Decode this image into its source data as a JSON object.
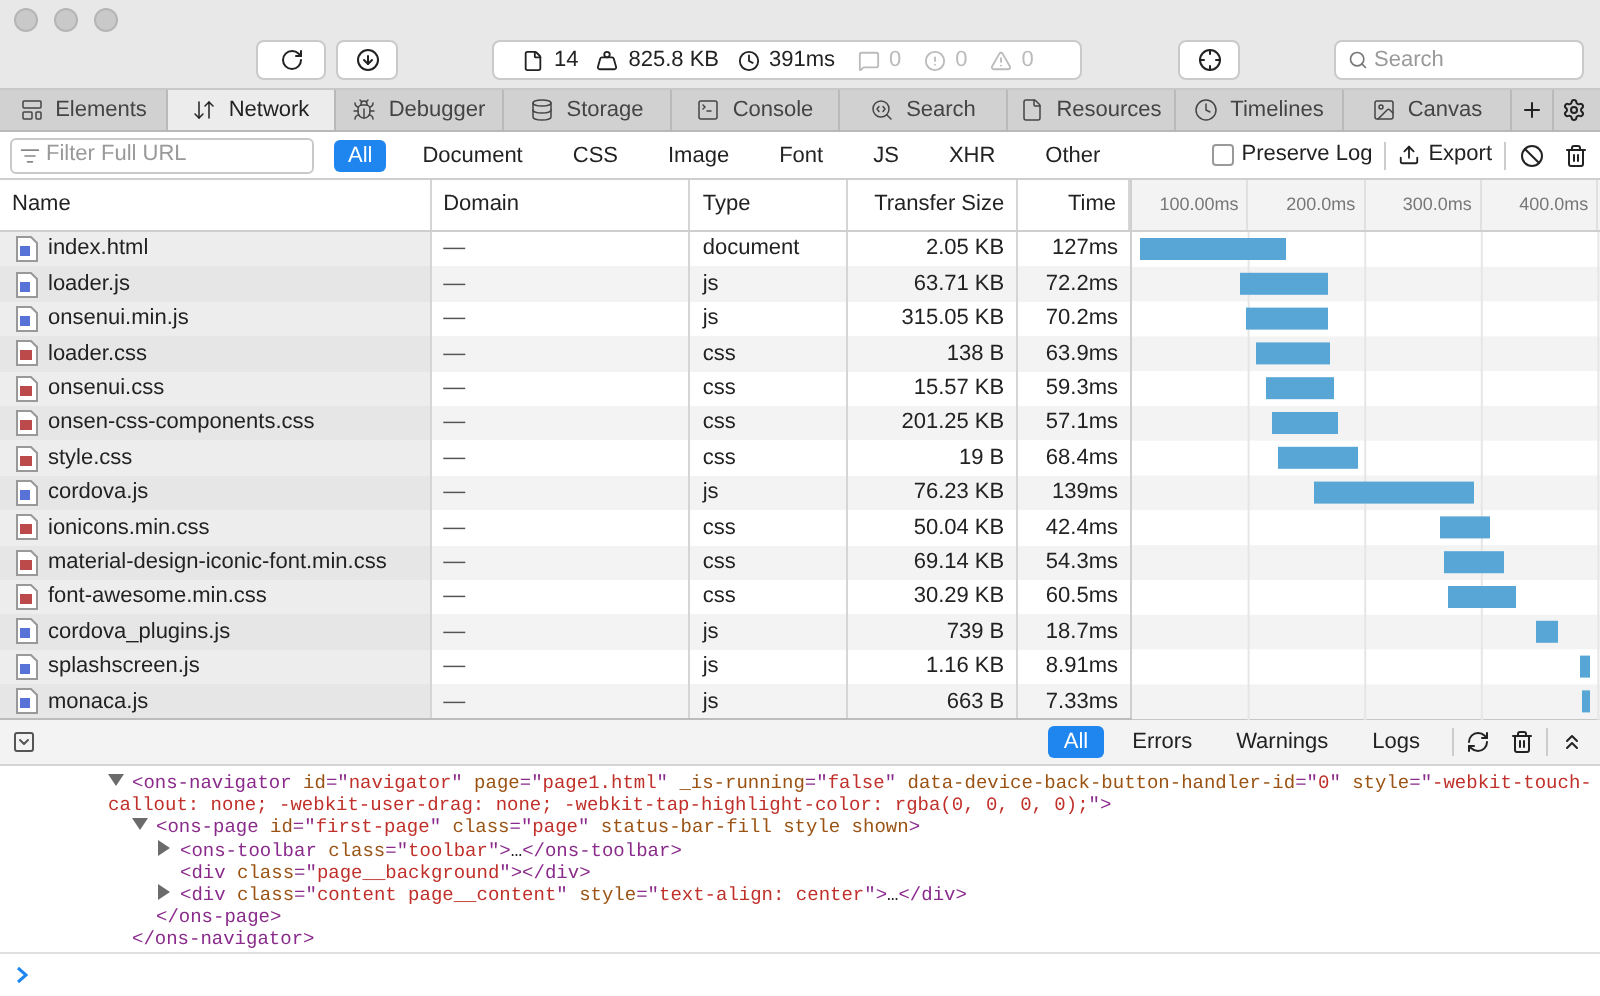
{
  "toolbar": {
    "resource_count": "14",
    "size": "825.8 KB",
    "time": "391ms",
    "messages": "0",
    "errors": "0",
    "warnings": "0",
    "search": {
      "placeholder": "Search"
    }
  },
  "tabs": [
    {
      "label": "Elements",
      "kind": "elements",
      "selected": false
    },
    {
      "label": "Network",
      "kind": "network",
      "selected": true
    },
    {
      "label": "Debugger",
      "kind": "debugger",
      "selected": false
    },
    {
      "label": "Storage",
      "kind": "storage",
      "selected": false
    },
    {
      "label": "Console",
      "kind": "console",
      "selected": false
    },
    {
      "label": "Search",
      "kind": "search",
      "selected": false
    },
    {
      "label": "Resources",
      "kind": "resources",
      "selected": false
    },
    {
      "label": "Timelines",
      "kind": "timelines",
      "selected": false
    },
    {
      "label": "Canvas",
      "kind": "canvas",
      "selected": false
    }
  ],
  "filter_bar": {
    "placeholder": "Filter Full URL",
    "filters": [
      {
        "label": "All",
        "selected": true
      },
      {
        "label": "Document",
        "selected": false
      },
      {
        "label": "CSS",
        "selected": false
      },
      {
        "label": "Image",
        "selected": false
      },
      {
        "label": "Font",
        "selected": false
      },
      {
        "label": "JS",
        "selected": false
      },
      {
        "label": "XHR",
        "selected": false
      },
      {
        "label": "Other",
        "selected": false
      }
    ],
    "preserve_log": {
      "label": "Preserve Log",
      "checked": false
    },
    "export": "Export"
  },
  "table": {
    "columns": [
      "Name",
      "Domain",
      "Type",
      "Transfer Size",
      "Time"
    ],
    "rows": [
      {
        "kind": "document",
        "name": "index.html",
        "domain": "—",
        "type": "document",
        "size": "2.05 KB",
        "time": "127ms"
      },
      {
        "kind": "script",
        "name": "loader.js",
        "domain": "—",
        "type": "js",
        "size": "63.71 KB",
        "time": "72.2ms"
      },
      {
        "kind": "script",
        "name": "onsenui.min.js",
        "domain": "—",
        "type": "js",
        "size": "315.05 KB",
        "time": "70.2ms"
      },
      {
        "kind": "stylesheet",
        "name": "loader.css",
        "domain": "—",
        "type": "css",
        "size": "138 B",
        "time": "63.9ms"
      },
      {
        "kind": "stylesheet",
        "name": "onsenui.css",
        "domain": "—",
        "type": "css",
        "size": "15.57 KB",
        "time": "59.3ms"
      },
      {
        "kind": "stylesheet",
        "name": "onsen-css-components.css",
        "domain": "—",
        "type": "css",
        "size": "201.25 KB",
        "time": "57.1ms"
      },
      {
        "kind": "stylesheet",
        "name": "style.css",
        "domain": "—",
        "type": "css",
        "size": "19 B",
        "time": "68.4ms"
      },
      {
        "kind": "script",
        "name": "cordova.js",
        "domain": "—",
        "type": "js",
        "size": "76.23 KB",
        "time": "139ms"
      },
      {
        "kind": "stylesheet",
        "name": "ionicons.min.css",
        "domain": "—",
        "type": "css",
        "size": "50.04 KB",
        "time": "42.4ms"
      },
      {
        "kind": "stylesheet",
        "name": "material-design-iconic-font.min.css",
        "domain": "—",
        "type": "css",
        "size": "69.14 KB",
        "time": "54.3ms"
      },
      {
        "kind": "stylesheet",
        "name": "font-awesome.min.css",
        "domain": "—",
        "type": "css",
        "size": "30.29 KB",
        "time": "60.5ms"
      },
      {
        "kind": "script",
        "name": "cordova_plugins.js",
        "domain": "—",
        "type": "js",
        "size": "739 B",
        "time": "18.7ms"
      },
      {
        "kind": "script",
        "name": "splashscreen.js",
        "domain": "—",
        "type": "js",
        "size": "1.16 KB",
        "time": "8.91ms"
      },
      {
        "kind": "script",
        "name": "monaca.js",
        "domain": "—",
        "type": "js",
        "size": "663 B",
        "time": "7.33ms"
      }
    ],
    "timeline_ticks": [
      "100.00ms",
      "200.0ms",
      "300.0ms",
      "400.0ms"
    ]
  },
  "console": {
    "filters": [
      {
        "label": "All",
        "selected": true
      },
      {
        "label": "Errors",
        "selected": false
      },
      {
        "label": "Warnings",
        "selected": false
      },
      {
        "label": "Logs",
        "selected": false
      }
    ],
    "tree": [
      {
        "expanded": true,
        "tokens": [
          {
            "kind": "tag",
            "t": "<ons-navigator"
          },
          {
            "kind": "attr",
            "t": " id"
          },
          {
            "kind": "tag",
            "t": "=\""
          },
          {
            "kind": "value",
            "t": "navigator"
          },
          {
            "kind": "tag",
            "t": "\""
          },
          {
            "kind": "attr",
            "t": " page"
          },
          {
            "kind": "tag",
            "t": "=\""
          },
          {
            "kind": "value",
            "t": "page1.html"
          },
          {
            "kind": "tag",
            "t": "\""
          },
          {
            "kind": "attr",
            "t": " _is-running"
          },
          {
            "kind": "tag",
            "t": "=\""
          },
          {
            "kind": "value",
            "t": "false"
          },
          {
            "kind": "tag",
            "t": "\""
          },
          {
            "kind": "attr",
            "t": " data-device-back-button-handler-id"
          },
          {
            "kind": "tag",
            "t": "=\""
          },
          {
            "kind": "value",
            "t": "0"
          },
          {
            "kind": "tag",
            "t": "\""
          },
          {
            "kind": "attr",
            "t": " style"
          },
          {
            "kind": "tag",
            "t": "=\""
          },
          {
            "kind": "value",
            "t": "-webkit-touch-callout: none; -webkit-user-drag: none; -webkit-tap-highlight-color: rgba(0, 0, 0, 0);"
          },
          {
            "kind": "tag",
            "t": "\">"
          }
        ],
        "children": [
          {
            "expanded": true,
            "tokens": [
              {
                "kind": "tag",
                "t": "<ons-page"
              },
              {
                "kind": "attr",
                "t": " id"
              },
              {
                "kind": "tag",
                "t": "=\""
              },
              {
                "kind": "value",
                "t": "first-page"
              },
              {
                "kind": "tag",
                "t": "\""
              },
              {
                "kind": "attr",
                "t": " class"
              },
              {
                "kind": "tag",
                "t": "=\""
              },
              {
                "kind": "value",
                "t": "page"
              },
              {
                "kind": "tag",
                "t": "\""
              },
              {
                "kind": "attr",
                "t": " status-bar-fill style shown"
              },
              {
                "kind": "tag",
                "t": ">"
              }
            ],
            "children": [
              {
                "expanded": false,
                "tokens": [
                  {
                    "kind": "tag",
                    "t": "<ons-toolbar"
                  },
                  {
                    "kind": "attr",
                    "t": " class"
                  },
                  {
                    "kind": "tag",
                    "t": "=\""
                  },
                  {
                    "kind": "value",
                    "t": "toolbar"
                  },
                  {
                    "kind": "tag",
                    "t": "\">"
                  },
                  {
                    "kind": "text",
                    "t": "…"
                  },
                  {
                    "kind": "tag",
                    "t": "</ons-toolbar>"
                  }
                ]
              },
              {
                "tokens": [
                  {
                    "kind": "tag",
                    "t": "<div"
                  },
                  {
                    "kind": "attr",
                    "t": " class"
                  },
                  {
                    "kind": "tag",
                    "t": "=\""
                  },
                  {
                    "kind": "value",
                    "t": "page__background"
                  },
                  {
                    "kind": "tag",
                    "t": "\"></div>"
                  }
                ]
              },
              {
                "expanded": false,
                "tokens": [
                  {
                    "kind": "tag",
                    "t": "<div"
                  },
                  {
                    "kind": "attr",
                    "t": " class"
                  },
                  {
                    "kind": "tag",
                    "t": "=\""
                  },
                  {
                    "kind": "value",
                    "t": "content page__content"
                  },
                  {
                    "kind": "tag",
                    "t": "\""
                  },
                  {
                    "kind": "attr",
                    "t": " style"
                  },
                  {
                    "kind": "tag",
                    "t": "=\""
                  },
                  {
                    "kind": "value",
                    "t": "text-align: center"
                  },
                  {
                    "kind": "tag",
                    "t": "\">"
                  },
                  {
                    "kind": "text",
                    "t": "…"
                  },
                  {
                    "kind": "tag",
                    "t": "</div>"
                  }
                ]
              }
            ],
            "close": [
              {
                "kind": "tag",
                "t": "</ons-page>"
              }
            ]
          }
        ],
        "close": [
          {
            "kind": "tag",
            "t": "</ons-navigator>"
          }
        ]
      }
    ]
  }
}
